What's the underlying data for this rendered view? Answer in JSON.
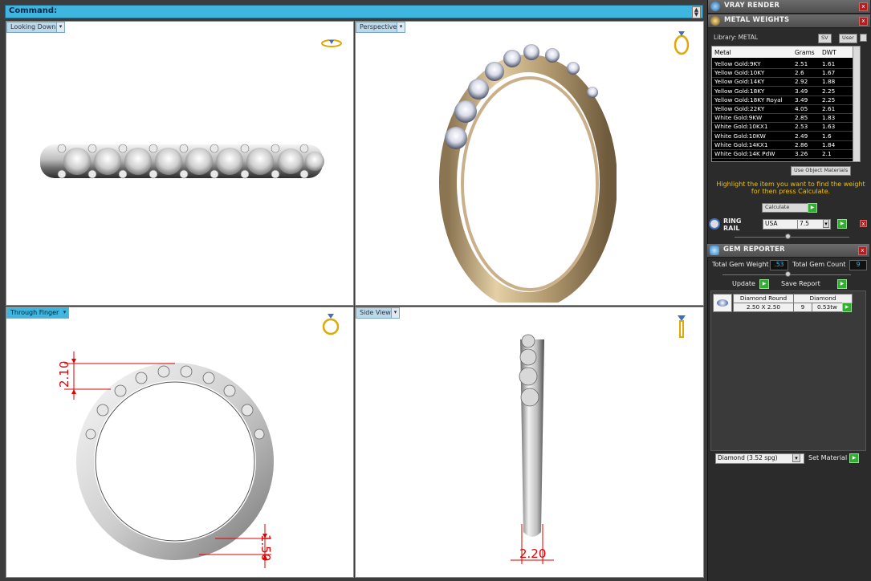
{
  "command": {
    "label": "Command:"
  },
  "viewports": {
    "top_left": {
      "tab": "Looking Down"
    },
    "top_right": {
      "tab": "Perspective"
    },
    "bottom_left": {
      "tab": "Through Finger",
      "dim_top": "2.10",
      "dim_bottom": "1.50"
    },
    "bottom_right": {
      "tab": "Side View",
      "dim_bottom": "2.20"
    }
  },
  "panel": {
    "vray": {
      "title": "VRAY RENDER"
    },
    "metal_weights": {
      "title": "METAL WEIGHTS",
      "library_label": "Library: METAL",
      "sv_button": "SV",
      "user_button": "User",
      "columns": [
        "Metal",
        "Grams",
        "DWT"
      ],
      "rows": [
        [
          "Yellow Gold:9KY",
          "2.51",
          "1.61"
        ],
        [
          "Yellow Gold:10KY",
          "2.6",
          "1.67"
        ],
        [
          "Yellow Gold:14KY",
          "2.92",
          "1.88"
        ],
        [
          "Yellow Gold:18KY",
          "3.49",
          "2.25"
        ],
        [
          "Yellow Gold:18KY Royal",
          "3.49",
          "2.25"
        ],
        [
          "Yellow Gold:22KY",
          "4.05",
          "2.61"
        ],
        [
          "White Gold:9KW",
          "2.85",
          "1.83"
        ],
        [
          "White Gold:10KX1",
          "2.53",
          "1.63"
        ],
        [
          "White Gold:10KW",
          "2.49",
          "1.6"
        ],
        [
          "White Gold:14KX1",
          "2.86",
          "1.84"
        ],
        [
          "White Gold:14K PdW",
          "3.26",
          "2.1"
        ]
      ],
      "use_object_label": "Use Object Materials",
      "hint": "Highlight the item you want to find the weight for then press Calculate.",
      "calculate_label": "Calculate"
    },
    "ring_rail": {
      "title": "RING RAIL",
      "standard": "USA",
      "size": "7.5"
    },
    "gem_reporter": {
      "title": "GEM REPORTER",
      "total_weight_label": "Total Gem Weight",
      "total_weight_value": ".53",
      "total_count_label": "Total Gem Count",
      "total_count_value": "9",
      "update_label": "Update",
      "save_report_label": "Save Report",
      "gem_rows": [
        {
          "shape": "Diamond Round",
          "size": "2.50 X 2.50",
          "material": "Diamond",
          "count": "9",
          "weight": "0.53tw"
        }
      ],
      "material_select": "Diamond      (3.52 spg)",
      "set_material_label": "Set Material"
    }
  }
}
